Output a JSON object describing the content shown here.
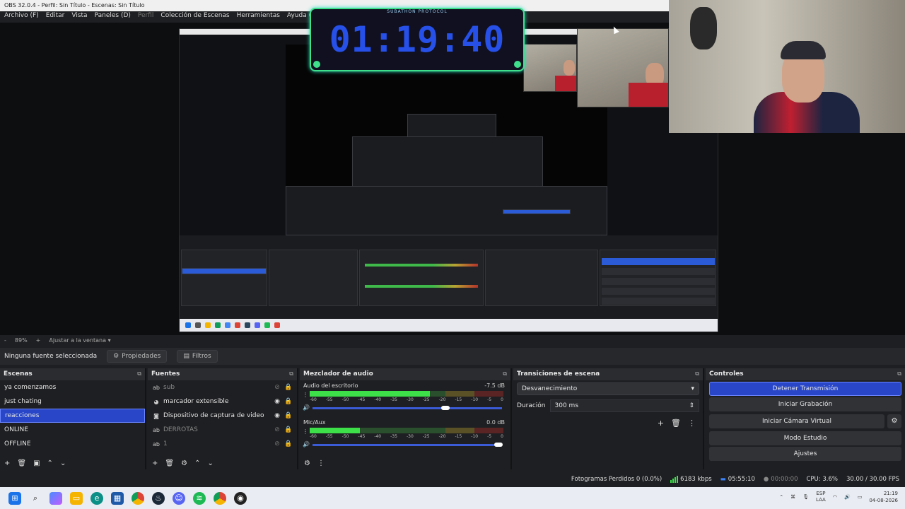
{
  "window": {
    "title": "OBS 32.0.4 - Perfil: Sin Título - Escenas: Sin Título"
  },
  "menu": [
    "Archivo (F)",
    "Editar",
    "Vista",
    "Paneles (D)",
    "Perfil",
    "Colección de Escenas",
    "Herramientas",
    "Ayuda (H)"
  ],
  "timer": {
    "label": "SUBATHON PROTOCOL",
    "value": "01:19:40",
    "accent": "#2650e8"
  },
  "zoom": {
    "level": "89%",
    "plus": "+",
    "minus": "-",
    "fit": "Ajustar a la ventana"
  },
  "source_bar": {
    "none_selected": "Ninguna fuente seleccionada",
    "properties": "Propiedades",
    "filters": "Filtros"
  },
  "scenes": {
    "title": "Escenas",
    "items": [
      "ya comenzamos",
      "just chating",
      "reacciones",
      "ONLINE",
      "OFFLINE"
    ],
    "selected_index": 2
  },
  "sources": {
    "title": "Fuentes",
    "items": [
      {
        "icon": "ab",
        "label": "sub",
        "visible": false
      },
      {
        "icon": "marker",
        "label": "marcador extensible",
        "visible": true
      },
      {
        "icon": "camera",
        "label": "Dispositivo de captura de video",
        "visible": true
      },
      {
        "icon": "ab",
        "label": "DERROTAS",
        "visible": false
      },
      {
        "icon": "ab",
        "label": "1",
        "visible": false
      }
    ]
  },
  "mixer": {
    "title": "Mezclador de audio",
    "channels": [
      {
        "name": "Audio del escritorio",
        "db": "-7.5 dB",
        "level": 0.62,
        "fader": 0.7
      },
      {
        "name": "Mic/Aux",
        "db": "0.0 dB",
        "level": 0.26,
        "fader": 0.98
      }
    ],
    "ticks": [
      "-60",
      "-55",
      "-50",
      "-45",
      "-40",
      "-35",
      "-30",
      "-25",
      "-20",
      "-15",
      "-10",
      "-5",
      "0"
    ]
  },
  "transitions": {
    "title": "Transiciones de escena",
    "type": "Desvanecimiento",
    "duration_label": "Duración",
    "duration_value": "300 ms"
  },
  "controls": {
    "title": "Controles",
    "stop_stream": "Detener Transmisión",
    "start_recording": "Iniciar Grabación",
    "start_virtual_cam": "Iniciar Cámara Virtual",
    "studio_mode": "Modo Estudio",
    "settings": "Ajustes"
  },
  "status": {
    "dropped": "Fotogramas Perdidos 0 (0.0%)",
    "bitrate": "6183 kbps",
    "stream_time": "05:55:10",
    "rec_time": "00:00:00",
    "cpu": "CPU: 3.6%",
    "fps": "30.00 / 30.00 FPS"
  },
  "tray": {
    "lang1": "ESP",
    "lang2": "LAA",
    "time": "21:19",
    "date": "04-08-2026"
  }
}
